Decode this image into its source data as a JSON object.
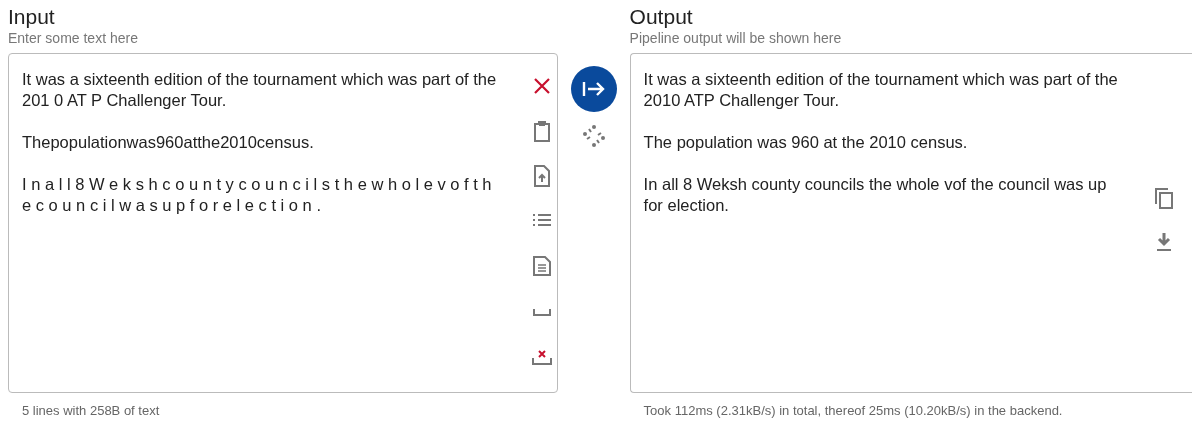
{
  "input": {
    "title": "Input",
    "subtitle": "Enter some text here",
    "value": "It was a sixteenth edition of the tournament which was part of the 201 0 AT P Challenger Tour.\n\nThepopulationwas960atthe2010census.\n\nI n a l l 8 W e k s h c o u n t y c o u n c i l s t h e w h o l e v o f t h e c o u n c i l w a s u p f o r e l e c t i o n .",
    "status": "5 lines with 258B of text",
    "tools": [
      {
        "kind": "clear"
      },
      {
        "kind": "paste"
      },
      {
        "kind": "upload"
      },
      {
        "kind": "list"
      },
      {
        "kind": "document"
      },
      {
        "kind": "space"
      },
      {
        "kind": "remove-space"
      }
    ]
  },
  "output": {
    "title": "Output",
    "subtitle": "Pipeline output will be shown here",
    "value": "It was a sixteenth edition of the tournament which was part of the 2010 ATP Challenger Tour.\n\nThe population was 960 at the 2010 census.\n\nIn all 8 Weksh county councils the whole vof the council was up for election.",
    "status": "Took 112ms (2.31kB/s) in total, thereof 25ms (10.20kB/s) in the backend.",
    "tools": [
      {
        "kind": "copy"
      },
      {
        "kind": "download"
      }
    ]
  }
}
